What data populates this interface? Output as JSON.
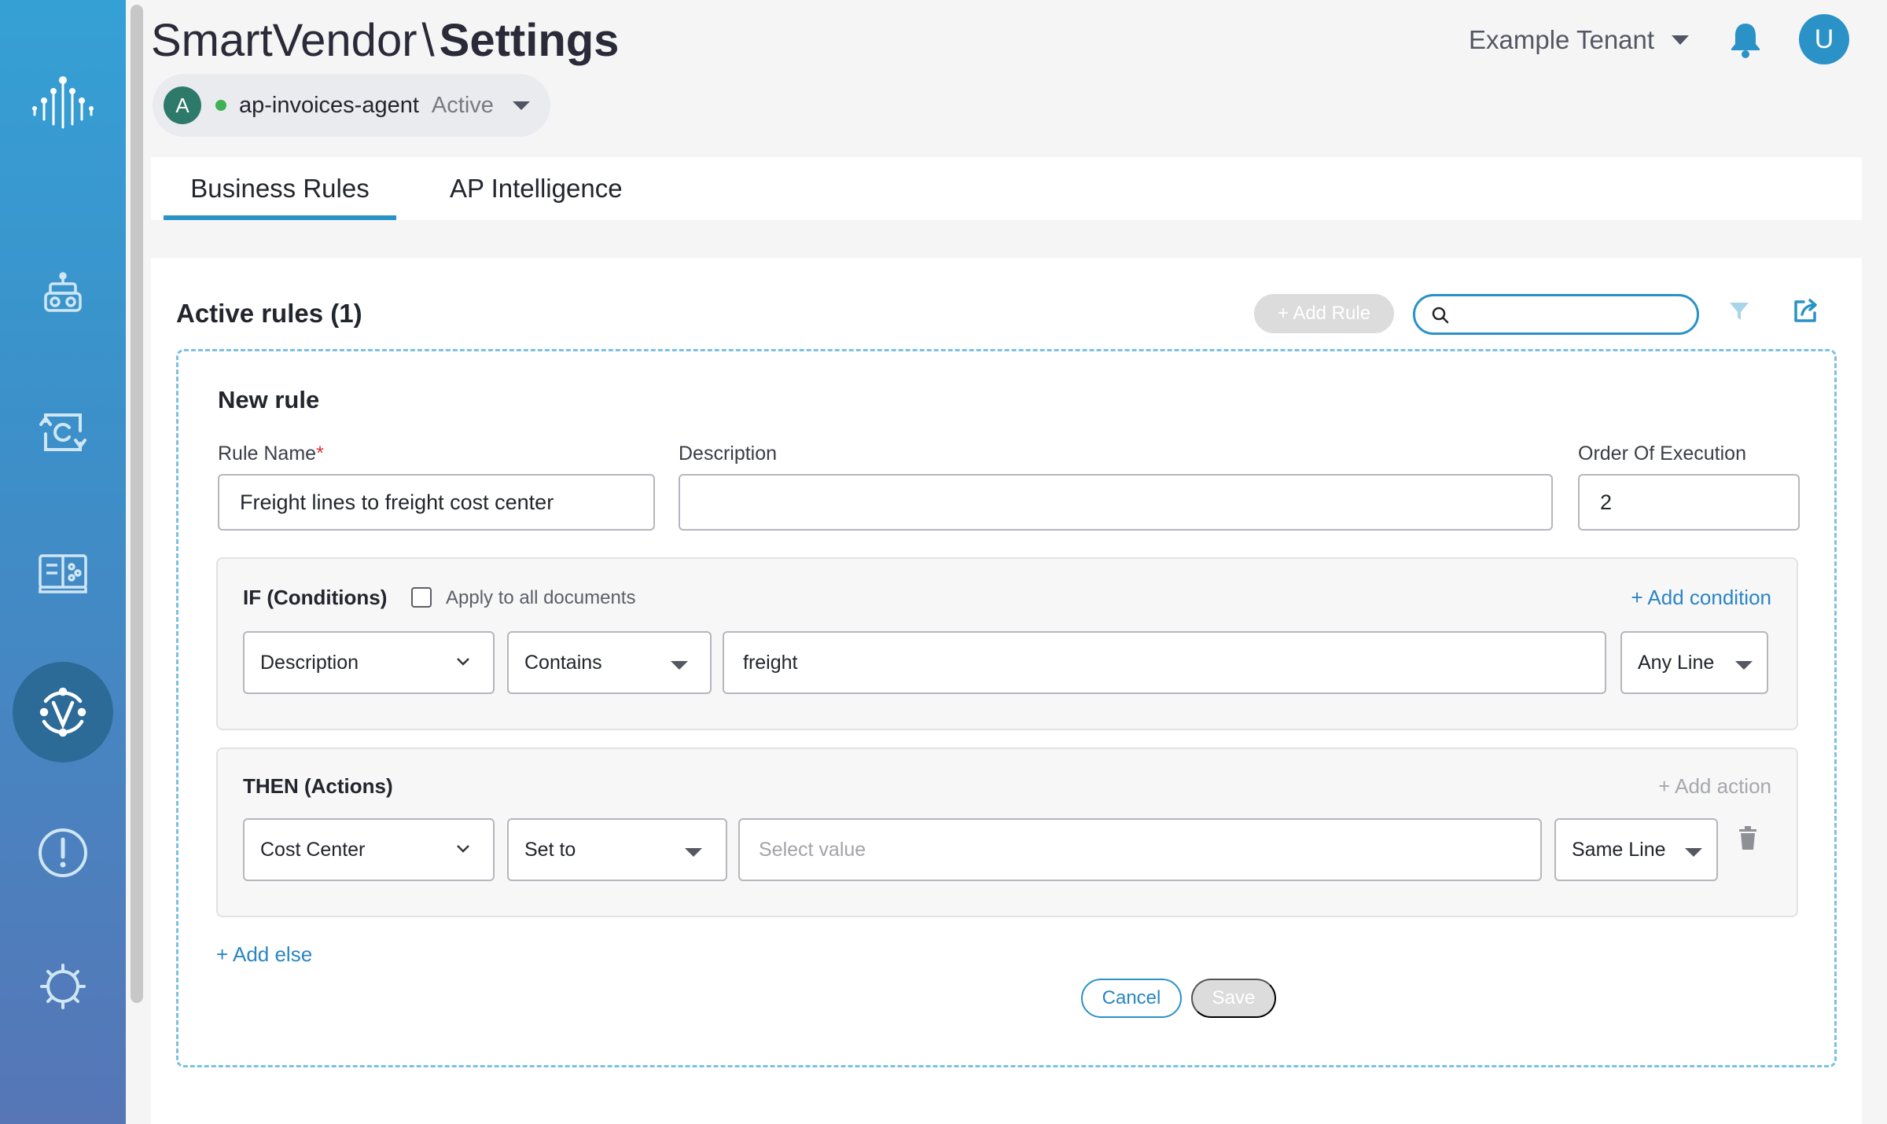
{
  "header": {
    "app_name": "SmartVendor",
    "separator": "\\",
    "page_title": "Settings",
    "tenant": "Example Tenant",
    "user_initial": "U"
  },
  "agent": {
    "initial": "A",
    "name": "ap-invoices-agent",
    "status": "Active",
    "status_color": "#3fb157"
  },
  "sidebar": {
    "items": [
      {
        "icon": "network-logo-icon"
      },
      {
        "icon": "robot-icon"
      },
      {
        "icon": "cycle-c-icon"
      },
      {
        "icon": "book-icon"
      },
      {
        "icon": "vendor-v-icon",
        "active": true
      },
      {
        "icon": "alert-circle-icon"
      },
      {
        "icon": "gear-icon"
      }
    ]
  },
  "tabs": [
    {
      "label": "Business Rules",
      "active": true
    },
    {
      "label": "AP Intelligence",
      "active": false
    }
  ],
  "rules": {
    "title": "Active rules (1)",
    "add_rule_label": "+ Add Rule",
    "search_placeholder": ""
  },
  "new_rule": {
    "heading": "New rule",
    "rule_name_label": "Rule Name",
    "rule_name_required": "*",
    "rule_name_value": "Freight lines to freight cost center",
    "description_label": "Description",
    "description_value": "",
    "order_label": "Order Of Execution",
    "order_value": "2",
    "conditions": {
      "title": "IF (Conditions)",
      "apply_all_label": "Apply to all documents",
      "apply_all_checked": false,
      "add_condition_label": "+ Add condition",
      "row": {
        "field": "Description",
        "operator": "Contains",
        "value": "freight",
        "scope": "Any Line"
      }
    },
    "actions": {
      "title": "THEN (Actions)",
      "add_action_label": "+ Add action",
      "row": {
        "field": "Cost Center",
        "operator": "Set to",
        "value_placeholder": "Select value",
        "scope": "Same Line"
      }
    },
    "add_else_label": "+ Add else",
    "cancel_label": "Cancel",
    "save_label": "Save"
  },
  "colors": {
    "accent": "#2a92c7",
    "link": "#2a86c2",
    "sidebar_top": "#35a0d4",
    "sidebar_bottom": "#5676b6"
  }
}
